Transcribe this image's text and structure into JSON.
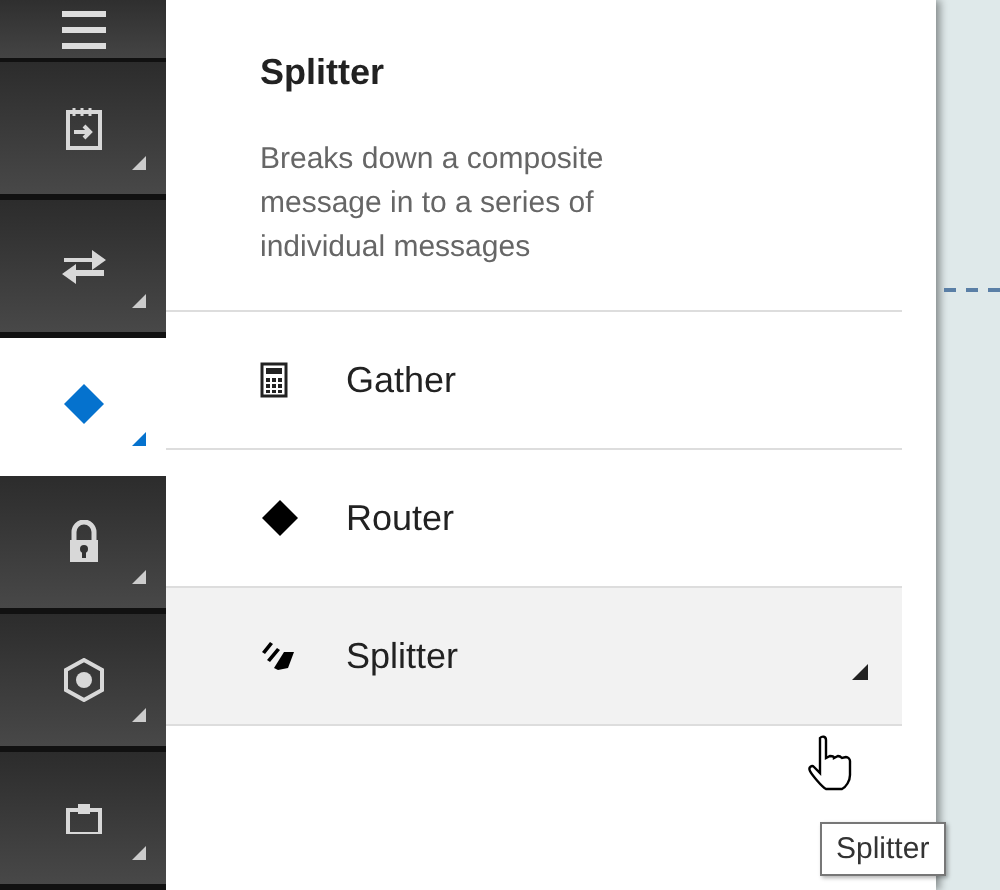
{
  "sidebar": {
    "items": [
      {
        "kind": "calendar",
        "selected": false
      },
      {
        "kind": "arrows",
        "selected": false
      },
      {
        "kind": "diamond",
        "selected": true
      },
      {
        "kind": "lock",
        "selected": false
      },
      {
        "kind": "hexagon",
        "selected": false
      },
      {
        "kind": "clipboard",
        "selected": false
      }
    ]
  },
  "palette": {
    "title": "Splitter",
    "description": "Breaks down a composite message in to a series of individual messages",
    "items": [
      {
        "label": "Gather",
        "kind": "calculator",
        "hovered": false
      },
      {
        "label": "Router",
        "kind": "diamond",
        "hovered": false
      },
      {
        "label": "Splitter",
        "kind": "splitter",
        "hovered": true
      }
    ]
  },
  "tooltip": "Splitter"
}
